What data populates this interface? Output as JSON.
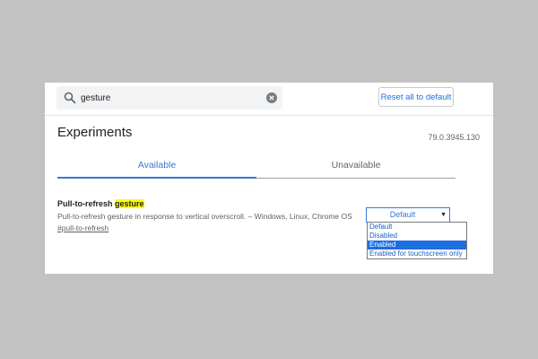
{
  "search": {
    "value": "gesture",
    "icon": "search-icon",
    "clear_icon": "clear-icon"
  },
  "toolbar": {
    "reset_label": "Reset all to default"
  },
  "header": {
    "title": "Experiments",
    "version": "79.0.3945.130"
  },
  "tabs": [
    {
      "label": "Available",
      "active": true
    },
    {
      "label": "Unavailable",
      "active": false
    }
  ],
  "flag": {
    "title_prefix": "Pull-to-refresh ",
    "title_match": "gesture",
    "description": "Pull-to-refresh gesture in response to vertical overscroll. – Windows, Linux, Chrome OS",
    "link": "#pull-to-refresh",
    "select_value": "Default",
    "options": [
      "Default",
      "Disabled",
      "Enabled",
      "Enabled for touchscreen only"
    ],
    "highlighted_option": "Enabled"
  },
  "colors": {
    "accent": "#3679d7",
    "highlight": "#ffff00",
    "selected_option_bg": "#1e6ee0"
  }
}
